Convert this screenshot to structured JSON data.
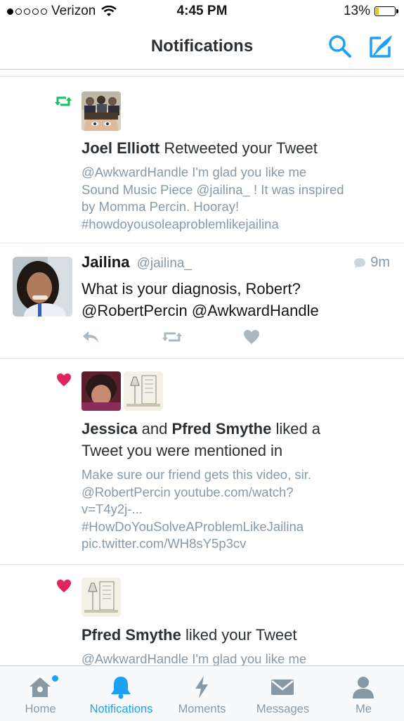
{
  "status_bar": {
    "carrier": "Verizon",
    "time": "4:45 PM",
    "battery": "13%",
    "battery_level": 0.13
  },
  "header": {
    "title": "Notifications"
  },
  "feed": {
    "n1": {
      "type": "retweet",
      "actor": "Joel Elliott",
      "action": "Retweeted your Tweet",
      "preview": [
        "@AwkwardHandle I'm glad you like me",
        "Sound Music Piece @jailina_ ! It was inspired",
        "by Momma Percin. Hooray!",
        "#howdoyousoleaproblemlikejailina"
      ]
    },
    "tweet": {
      "name": "Jailina",
      "handle": "@jailina_",
      "time": "9m",
      "text_line1": "What is your diagnosis, Robert?",
      "text_line2": "@RobertPercin @AwkwardHandle"
    },
    "n2": {
      "type": "like",
      "actor1": "Jessica",
      "joiner": "and",
      "actor2": "Pfred Smythe",
      "action1": "liked a",
      "action2": "Tweet you were mentioned in",
      "preview": [
        "Make sure our friend gets this video, sir.",
        "@RobertPercin youtube.com/watch?",
        "v=T4y2j-...",
        "#HowDoYouSolveAProblemLikeJailina",
        "pic.twitter.com/WH8sY5p3cv"
      ]
    },
    "n3": {
      "type": "like",
      "actor": "Pfred Smythe",
      "action": "liked your Tweet",
      "preview": [
        "@AwkwardHandle I'm glad you like me"
      ]
    }
  },
  "tabs": {
    "home": {
      "label": "Home",
      "icon": "home-icon"
    },
    "notifications": {
      "label": "Notifications",
      "icon": "bell-icon"
    },
    "moments": {
      "label": "Moments",
      "icon": "lightning-icon"
    },
    "messages": {
      "label": "Messages",
      "icon": "envelope-icon"
    },
    "me": {
      "label": "Me",
      "icon": "person-icon"
    }
  },
  "colors": {
    "accent": "#1da1f2",
    "retweet": "#17bf63",
    "like": "#e0245e",
    "muted": "#8899a6"
  }
}
